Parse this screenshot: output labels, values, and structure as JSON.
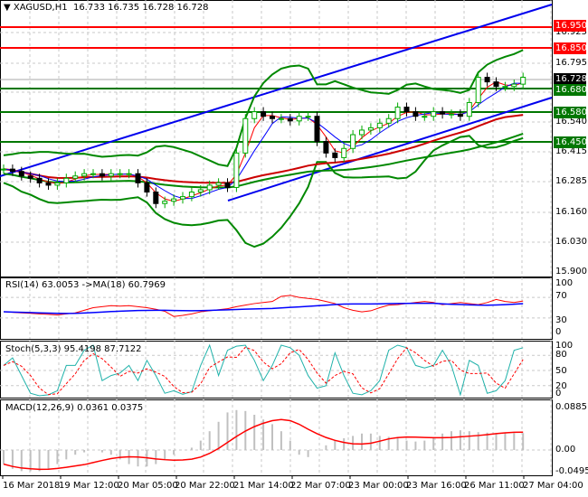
{
  "header": {
    "symbol": "XAGUSD,H1",
    "open": "16.733",
    "high": "16.735",
    "low": "16.728",
    "close": "16.728"
  },
  "colors": {
    "bull": "#00aa00",
    "bear": "#000000",
    "support": "#007700",
    "resistance": "#ff0000",
    "channel": "#0000ee",
    "rsi": "#ff0000",
    "rsi_ma": "#0000ff",
    "stoch_k": "#20b2aa",
    "stoch_d": "#ff0000",
    "macd_hist": "#c0c0c0",
    "macd_signal": "#ff0000"
  },
  "price_axis": {
    "ticks": [
      "16.925",
      "16.795",
      "16.540",
      "16.415",
      "16.285",
      "16.160",
      "16.030",
      "15.900"
    ]
  },
  "levels": [
    {
      "value": "16.950",
      "kind": "resistance"
    },
    {
      "value": "16.850",
      "kind": "resistance"
    },
    {
      "value": "16.728",
      "kind": "current"
    },
    {
      "value": "16.680",
      "kind": "support"
    },
    {
      "value": "16.580",
      "kind": "support"
    },
    {
      "value": "16.450",
      "kind": "support"
    }
  ],
  "indicators": {
    "rsi": {
      "label": "RSI(14) 63.0053  ->MA(18) 60.7969",
      "ticks": [
        "100",
        "70",
        "30",
        "0"
      ]
    },
    "stoch": {
      "label": "Stoch(5,3,3) 95.4198 87.7122",
      "ticks": [
        "100",
        "80",
        "50",
        "20",
        "0"
      ]
    },
    "macd": {
      "label": "MACD(12,26,9) 0.0361 0.0375",
      "ticks": [
        "0.0885",
        "0.00",
        "-0.0495"
      ]
    }
  },
  "time_axis": [
    "16 Mar 2018",
    "19 Mar 12:00",
    "20 Mar 05:00",
    "20 Mar 22:00",
    "21 Mar 14:00",
    "22 Mar 07:00",
    "23 Mar 00:00",
    "23 Mar 16:00",
    "26 Mar 11:00",
    "27 Mar 04:00"
  ],
  "chart_data": {
    "type": "line",
    "title": "XAGUSD,H1",
    "ylim": [
      15.9,
      16.96
    ],
    "close": [
      16.33,
      16.32,
      16.3,
      16.29,
      16.27,
      16.26,
      16.27,
      16.29,
      16.3,
      16.31,
      16.31,
      16.3,
      16.31,
      16.31,
      16.31,
      16.27,
      16.23,
      16.18,
      16.19,
      16.2,
      16.21,
      16.23,
      16.24,
      16.26,
      16.27,
      16.25,
      16.4,
      16.55,
      16.58,
      16.56,
      16.55,
      16.55,
      16.54,
      16.56,
      16.56,
      16.45,
      16.4,
      16.38,
      16.42,
      16.48,
      16.5,
      16.51,
      16.53,
      16.55,
      16.6,
      16.58,
      16.56,
      16.56,
      16.58,
      16.57,
      16.57,
      16.56,
      16.62,
      16.73,
      16.71,
      16.69,
      16.69,
      16.7,
      16.73
    ],
    "rsi": [
      42,
      41,
      40,
      39,
      38,
      37,
      36,
      38,
      40,
      45,
      50,
      52,
      54,
      53,
      54,
      52,
      50,
      47,
      43,
      33,
      35,
      38,
      42,
      44,
      46,
      48,
      52,
      55,
      58,
      60,
      62,
      72,
      74,
      70,
      68,
      66,
      62,
      58,
      50,
      45,
      42,
      44,
      50,
      55,
      56,
      58,
      60,
      62,
      60,
      56,
      58,
      60,
      58,
      56,
      60,
      66,
      62,
      60,
      63
    ],
    "stoch_k": [
      60,
      75,
      40,
      5,
      0,
      2,
      10,
      60,
      60,
      90,
      100,
      30,
      40,
      45,
      60,
      30,
      70,
      40,
      5,
      10,
      3,
      8,
      60,
      100,
      40,
      90,
      98,
      100,
      70,
      30,
      60,
      100,
      95,
      80,
      40,
      15,
      20,
      85,
      40,
      5,
      2,
      10,
      30,
      90,
      100,
      95,
      60,
      55,
      60,
      90,
      60,
      2,
      70,
      60,
      5,
      10,
      30,
      90,
      95
    ],
    "macd_hist": [
      -0.03,
      -0.04,
      -0.045,
      -0.045,
      -0.045,
      -0.04,
      -0.03,
      -0.02,
      -0.01,
      -0.005,
      0,
      -0.005,
      -0.01,
      -0.02,
      -0.03,
      -0.035,
      -0.035,
      -0.03,
      -0.02,
      -0.01,
      0,
      0.005,
      0.02,
      0.04,
      0.06,
      0.08,
      0.085,
      0.083,
      0.075,
      0.065,
      0.055,
      0.04,
      0.02,
      -0.01,
      -0.015,
      0,
      0.01,
      0.02,
      0.025,
      0.03,
      0.035,
      0.035,
      0.03,
      0.028,
      0.025,
      0.02,
      0.018,
      0.02,
      0.025,
      0.035,
      0.04,
      0.042,
      0.04,
      0.038,
      0.037,
      0.036,
      0.036,
      0.036,
      0.036
    ]
  }
}
